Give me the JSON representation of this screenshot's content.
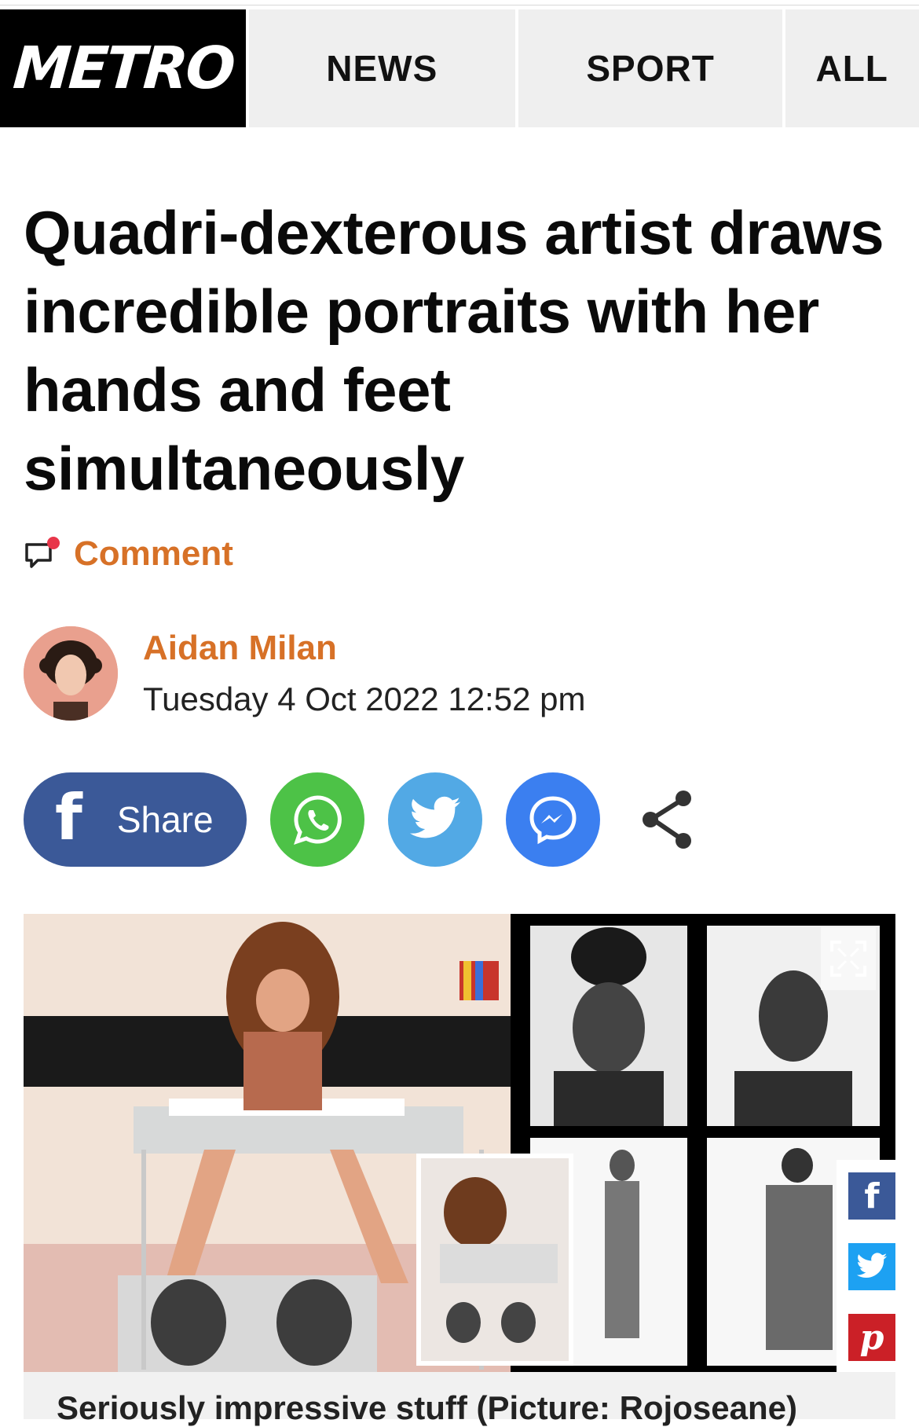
{
  "nav": {
    "logo": "METRO",
    "items": [
      "NEWS",
      "SPORT",
      "ALL"
    ]
  },
  "article": {
    "headline": "Quadri-dexterous artist draws incredible portraits with her hands and feet simultaneously",
    "comment_label": "Comment",
    "author": "Aidan Milan",
    "date": "Tuesday 4 Oct 2022 12:52 pm"
  },
  "share": {
    "facebook_label": "Share",
    "icons": [
      "facebook-icon",
      "whatsapp-icon",
      "twitter-icon",
      "messenger-icon",
      "share-icon"
    ]
  },
  "image": {
    "caption": "Seriously impressive stuff (Picture: Rojoseane)",
    "side_share_icons": [
      "facebook-icon",
      "twitter-icon",
      "pinterest-icon"
    ]
  },
  "colors": {
    "accent": "#d77127",
    "facebook": "#3b5998",
    "whatsapp": "#4dc247",
    "twitter": "#52a9e5",
    "messenger": "#3b7ff0",
    "pinterest": "#cb2027"
  }
}
